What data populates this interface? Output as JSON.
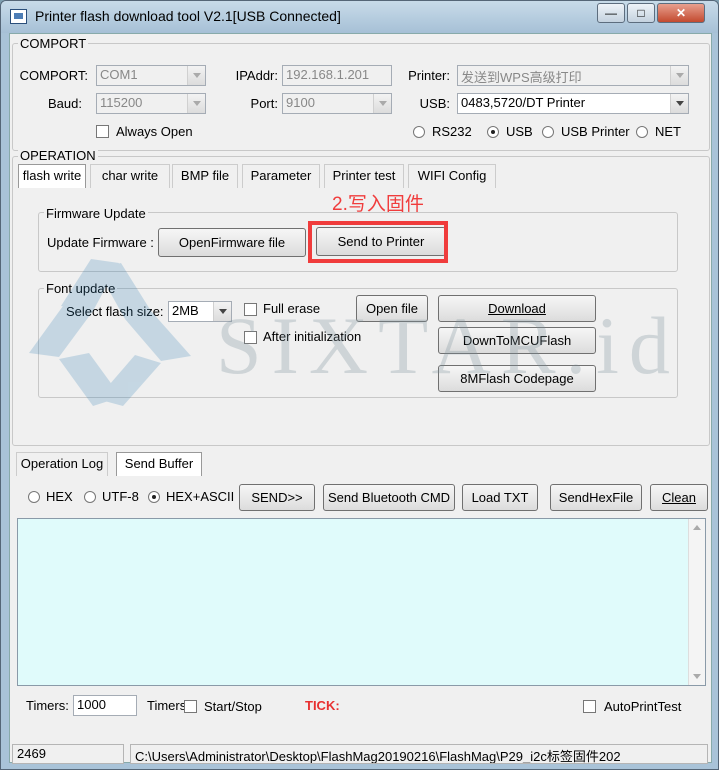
{
  "window": {
    "title": "Printer flash download tool V2.1[USB Connected]"
  },
  "comport_group": {
    "legend": "COMPORT",
    "comport_label": "COMPORT:",
    "comport_value": "COM1",
    "baud_label": "Baud:",
    "baud_value": "115200",
    "ipaddr_label": "IPAddr:",
    "ipaddr_value": "192.168.1.201",
    "port_label": "Port:",
    "port_value": "9100",
    "printer_label": "Printer:",
    "printer_value": "发送到WPS高级打印",
    "usb_label": "USB:",
    "usb_value": "0483,5720/DT Printer",
    "always_open_label": "Always Open",
    "radios": {
      "rs232": "RS232",
      "usb": "USB",
      "usb_printer": "USB Printer",
      "net": "NET"
    },
    "selected_interface": "USB"
  },
  "operation_group": {
    "legend": "OPERATION",
    "tabs": [
      "flash write",
      "char write",
      "BMP file",
      "Parameter",
      "Printer test",
      "WIFI Config"
    ],
    "active_tab": "flash write",
    "annotation": "2.写入固件",
    "firmware": {
      "legend": "Firmware Update",
      "label": "Update Firmware :",
      "open_button": "OpenFirmware file",
      "send_button": "Send to Printer"
    },
    "font": {
      "legend": "Font update",
      "size_label": "Select flash size:",
      "size_value": "2MB",
      "full_erase": "Full erase",
      "after_init": "After initialization",
      "open_file": "Open file",
      "download": "Download",
      "down_to_mcu": "DownToMCUFlash",
      "codepage": "8MFlash Codepage"
    }
  },
  "bottom": {
    "tabs": [
      "Operation Log",
      "Send Buffer"
    ],
    "active_tab": "Send Buffer",
    "encoding": {
      "hex": "HEX",
      "utf8": "UTF-8",
      "hexascii": "HEX+ASCII",
      "selected": "HEX+ASCII"
    },
    "buttons": {
      "send": "SEND>>",
      "send_bt": "Send Bluetooth CMD",
      "load_txt": "Load TXT",
      "send_hex": "SendHexFile",
      "clean": "Clean"
    },
    "timers_label": "Timers:",
    "timers_value": "1000",
    "timers_chk_label": "Timers",
    "start_stop": "Start/Stop",
    "tick": "TICK:",
    "auto_print": "AutoPrintTest"
  },
  "statusbar": {
    "count": "2469",
    "path": "C:\\Users\\Administrator\\Desktop\\FlashMag20190216\\FlashMag\\P29_i2c标签固件202"
  },
  "watermark": {
    "text": "SIXTAR.id"
  },
  "colors": {
    "annotation_red": "#f03c3c",
    "log_bg": "#e0fbfb",
    "titlebar": "#a9c3d8"
  }
}
